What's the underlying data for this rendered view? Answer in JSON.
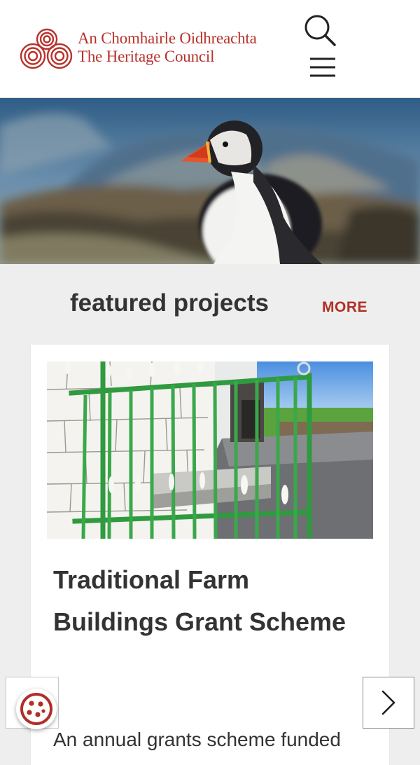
{
  "header": {
    "logo_line1": "An Chomhairle Oidhreachta",
    "logo_line2": "The Heritage Council",
    "brand_color": "#b8322c",
    "search_icon": "search-icon",
    "menu_icon": "hamburger-menu-icon"
  },
  "hero": {
    "subject": "puffin"
  },
  "featured": {
    "title": "featured projects",
    "more_label": "MORE"
  },
  "card": {
    "title": "Traditional Farm Buildings Grant Scheme",
    "description": "An annual grants scheme funded"
  },
  "controls": {
    "cookie_icon": "cookie-icon",
    "next_icon": "chevron-right-icon"
  },
  "colors": {
    "accent": "#b03024",
    "page_bg": "#eeeeee",
    "text": "#333333"
  }
}
